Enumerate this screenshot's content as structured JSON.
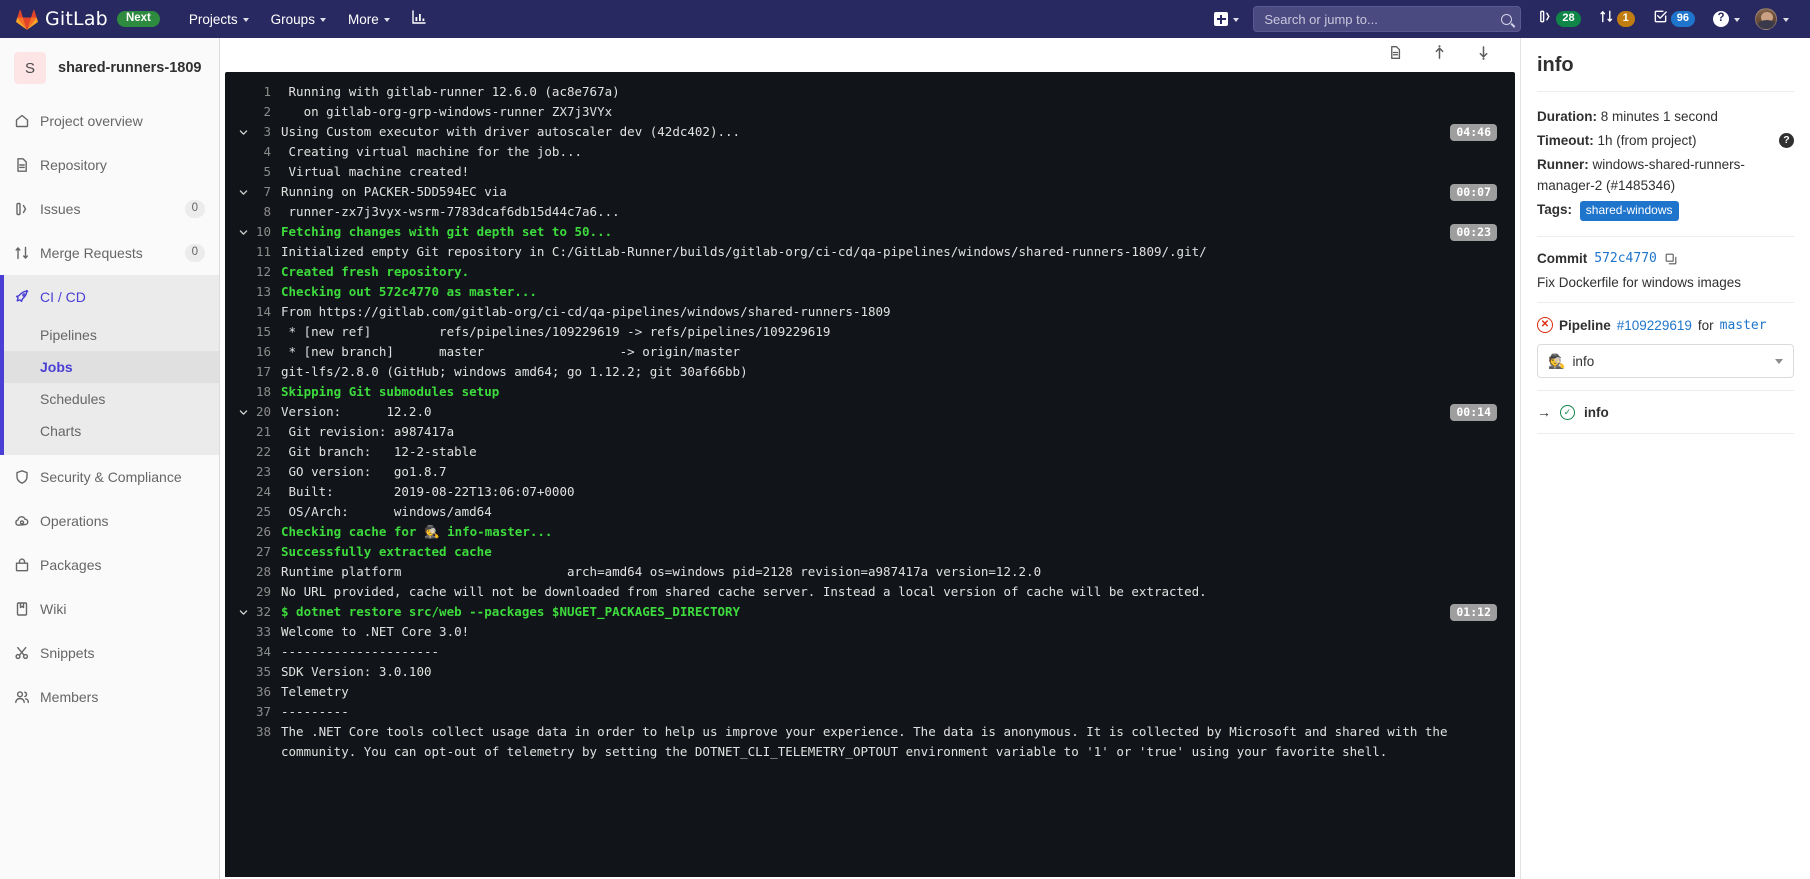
{
  "topnav": {
    "brand": "GitLab",
    "next_badge": "Next",
    "menus": [
      {
        "label": "Projects",
        "icon": "chevron-down-icon"
      },
      {
        "label": "Groups",
        "icon": "chevron-down-icon"
      },
      {
        "label": "More",
        "icon": "chevron-down-icon"
      }
    ],
    "analytics_icon": "bar-chart-icon",
    "create_icon": "plus-square-icon",
    "search": {
      "placeholder": "Search or jump to...",
      "value": "",
      "icon": "search-icon"
    },
    "counters": [
      {
        "name": "issues",
        "icon": "issues-icon",
        "count": "28",
        "color": "#108548"
      },
      {
        "name": "merge-requests",
        "icon": "merge-request-icon",
        "count": "1",
        "color": "#c17d10"
      },
      {
        "name": "todos",
        "icon": "todo-icon",
        "count": "96",
        "color": "#1f75cb"
      }
    ],
    "help": {
      "label": "?",
      "icon": "question-circle-icon"
    },
    "user": {
      "icon": "avatar"
    }
  },
  "sidebar": {
    "project": {
      "initial": "S",
      "name": "shared-runners-1809"
    },
    "items": [
      {
        "label": "Project overview",
        "icon": "home-icon",
        "count": null
      },
      {
        "label": "Repository",
        "icon": "document-icon",
        "count": null
      },
      {
        "label": "Issues",
        "icon": "issues-icon",
        "count": "0"
      },
      {
        "label": "Merge Requests",
        "icon": "merge-request-icon",
        "count": "0"
      },
      {
        "label": "CI / CD",
        "icon": "rocket-icon",
        "count": null,
        "active": true
      },
      {
        "label": "Security & Compliance",
        "icon": "shield-icon",
        "count": null
      },
      {
        "label": "Operations",
        "icon": "cloud-gear-icon",
        "count": null
      },
      {
        "label": "Packages",
        "icon": "package-icon",
        "count": null
      },
      {
        "label": "Wiki",
        "icon": "book-icon",
        "count": null
      },
      {
        "label": "Snippets",
        "icon": "snippet-icon",
        "count": null
      },
      {
        "label": "Members",
        "icon": "users-icon",
        "count": null
      }
    ],
    "cicd_sub": [
      {
        "label": "Pipelines",
        "current": false
      },
      {
        "label": "Jobs",
        "current": true
      },
      {
        "label": "Schedules",
        "current": false
      },
      {
        "label": "Charts",
        "current": false
      }
    ]
  },
  "log_toolbar": {
    "raw_icon": "document-icon",
    "scroll_top_icon": "scroll-to-top-icon",
    "scroll_bottom_icon": "scroll-to-bottom-icon"
  },
  "log": {
    "lines": [
      {
        "num": "1",
        "text": " Running with gitlab-runner 12.6.0 (ac8e767a)",
        "style": "plain"
      },
      {
        "num": "2",
        "text": "   on gitlab-org-grp-windows-runner ZX7j3VYx",
        "style": "plain"
      },
      {
        "num": "3",
        "text": "Using Custom executor with driver autoscaler dev (42dc402)...",
        "style": "plain",
        "collapsible": true,
        "time": "04:46"
      },
      {
        "num": "4",
        "text": " Creating virtual machine for the job...",
        "style": "plain"
      },
      {
        "num": "5",
        "text": " Virtual machine created!",
        "style": "plain"
      },
      {
        "num": "7",
        "text": "Running on PACKER-5DD594EC via",
        "style": "plain",
        "collapsible": true,
        "time": "00:07"
      },
      {
        "num": "8",
        "text": " runner-zx7j3vyx-wsrm-7783dcaf6db15d44c7a6...",
        "style": "plain"
      },
      {
        "num": "10",
        "text": "Fetching changes with git depth set to 50...",
        "style": "green",
        "collapsible": true,
        "time": "00:23"
      },
      {
        "num": "11",
        "text": "Initialized empty Git repository in C:/GitLab-Runner/builds/gitlab-org/ci-cd/qa-pipelines/windows/shared-runners-1809/.git/",
        "style": "plain"
      },
      {
        "num": "12",
        "text": "Created fresh repository.",
        "style": "green"
      },
      {
        "num": "13",
        "text": "Checking out 572c4770 as master...",
        "style": "green"
      },
      {
        "num": "14",
        "text": "From https://gitlab.com/gitlab-org/ci-cd/qa-pipelines/windows/shared-runners-1809",
        "style": "plain"
      },
      {
        "num": "15",
        "text": " * [new ref]         refs/pipelines/109229619 -> refs/pipelines/109229619",
        "style": "plain"
      },
      {
        "num": "16",
        "text": " * [new branch]      master                  -> origin/master",
        "style": "plain"
      },
      {
        "num": "17",
        "text": "git-lfs/2.8.0 (GitHub; windows amd64; go 1.12.2; git 30af66bb)",
        "style": "plain"
      },
      {
        "num": "18",
        "text": "Skipping Git submodules setup",
        "style": "green"
      },
      {
        "num": "20",
        "text": "Version:      12.2.0",
        "style": "plain",
        "collapsible": true,
        "time": "00:14"
      },
      {
        "num": "21",
        "text": " Git revision: a987417a",
        "style": "plain"
      },
      {
        "num": "22",
        "text": " Git branch:   12-2-stable",
        "style": "plain"
      },
      {
        "num": "23",
        "text": " GO version:   go1.8.7",
        "style": "plain"
      },
      {
        "num": "24",
        "text": " Built:        2019-08-22T13:06:07+0000",
        "style": "plain"
      },
      {
        "num": "25",
        "text": " OS/Arch:      windows/amd64",
        "style": "plain"
      },
      {
        "num": "26",
        "text": "Checking cache for 🕵 info-master...",
        "style": "green"
      },
      {
        "num": "27",
        "text": "Successfully extracted cache",
        "style": "green"
      },
      {
        "num": "28",
        "text": "Runtime platform                      arch=amd64 os=windows pid=2128 revision=a987417a version=12.2.0",
        "style": "plain"
      },
      {
        "num": "29",
        "text": "No URL provided, cache will not be downloaded from shared cache server. Instead a local version of cache will be extracted.",
        "style": "plain"
      },
      {
        "num": "32",
        "text": "$ dotnet restore src/web --packages $NUGET_PACKAGES_DIRECTORY",
        "style": "green",
        "collapsible": true,
        "time": "01:12"
      },
      {
        "num": "33",
        "text": "Welcome to .NET Core 3.0!",
        "style": "plain"
      },
      {
        "num": "34",
        "text": "---------------------",
        "style": "plain"
      },
      {
        "num": "35",
        "text": "SDK Version: 3.0.100",
        "style": "plain"
      },
      {
        "num": "36",
        "text": "Telemetry",
        "style": "plain"
      },
      {
        "num": "37",
        "text": "---------",
        "style": "plain"
      },
      {
        "num": "38",
        "text": "The .NET Core tools collect usage data in order to help us improve your experience. The data is anonymous. It is collected by Microsoft and shared with the community. You can opt-out of telemetry by setting the DOTNET_CLI_TELEMETRY_OPTOUT environment variable to '1' or 'true' using your favorite shell.",
        "style": "plain"
      }
    ]
  },
  "info": {
    "title": "info",
    "duration_label": "Duration:",
    "duration_value": "8 minutes 1 second",
    "timeout_label": "Timeout:",
    "timeout_value": "1h (from project)",
    "timeout_help_icon": "question-circle-icon",
    "runner_label": "Runner:",
    "runner_value": "windows-shared-runners-manager-2 (#1485346)",
    "tags_label": "Tags:",
    "tags": [
      "shared-windows"
    ],
    "commit_label": "Commit",
    "commit_sha": "572c4770",
    "copy_icon": "copy-icon",
    "commit_message": "Fix Dockerfile for windows images",
    "pipeline_status_icon": "status-failed-icon",
    "pipeline_label": "Pipeline",
    "pipeline_id": "#109229619",
    "pipeline_for": "for",
    "pipeline_ref": "master",
    "stage_select": {
      "emoji": "🕵",
      "value": "info",
      "caret": "chevron-down-icon"
    },
    "current_job": {
      "arrow": "→",
      "status_icon": "status-success-icon",
      "name": "info"
    }
  },
  "colors": {
    "nav_bg": "#292961",
    "accent": "#4a3fd4",
    "link": "#1f75cb",
    "success": "#108548",
    "danger": "#dd2b0e",
    "terminal_bg": "#111418",
    "terminal_green": "#3ddb3d"
  }
}
